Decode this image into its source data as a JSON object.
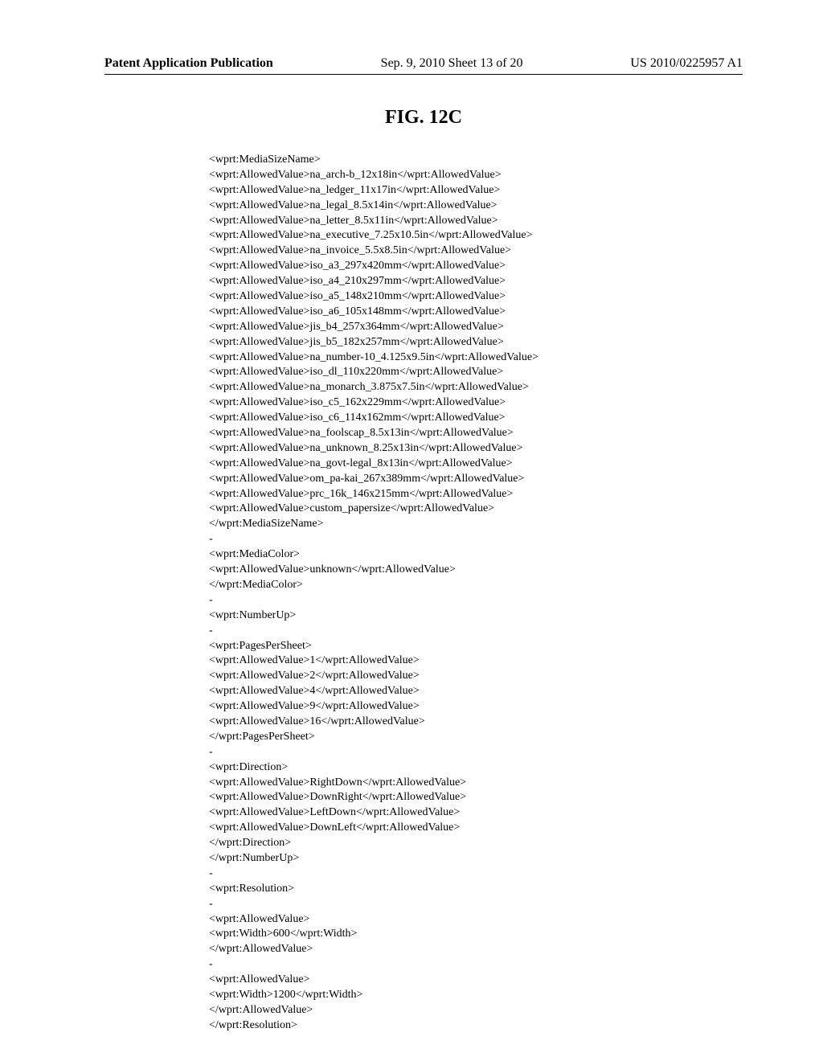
{
  "header": {
    "left": "Patent Application Publication",
    "center": "Sep. 9, 2010  Sheet 13 of 20",
    "right": "US 2010/0225957 A1"
  },
  "figure_title": "FIG. 12C",
  "xml": {
    "media_size_name": {
      "open": "<wprt:MediaSizeName>",
      "lines": [
        "<wprt:AllowedValue>na_arch-b_12x18in</wprt:AllowedValue>",
        "<wprt:AllowedValue>na_ledger_11x17in</wprt:AllowedValue>",
        "<wprt:AllowedValue>na_legal_8.5x14in</wprt:AllowedValue>",
        "<wprt:AllowedValue>na_letter_8.5x11in</wprt:AllowedValue>",
        "<wprt:AllowedValue>na_executive_7.25x10.5in</wprt:AllowedValue>",
        "<wprt:AllowedValue>na_invoice_5.5x8.5in</wprt:AllowedValue>",
        "<wprt:AllowedValue>iso_a3_297x420mm</wprt:AllowedValue>",
        "<wprt:AllowedValue>iso_a4_210x297mm</wprt:AllowedValue>",
        "<wprt:AllowedValue>iso_a5_148x210mm</wprt:AllowedValue>",
        "<wprt:AllowedValue>iso_a6_105x148mm</wprt:AllowedValue>",
        "<wprt:AllowedValue>jis_b4_257x364mm</wprt:AllowedValue>",
        "<wprt:AllowedValue>jis_b5_182x257mm</wprt:AllowedValue>",
        "<wprt:AllowedValue>na_number-10_4.125x9.5in</wprt:AllowedValue>",
        "<wprt:AllowedValue>iso_dl_110x220mm</wprt:AllowedValue>",
        "<wprt:AllowedValue>na_monarch_3.875x7.5in</wprt:AllowedValue>",
        "<wprt:AllowedValue>iso_c5_162x229mm</wprt:AllowedValue>",
        "<wprt:AllowedValue>iso_c6_114x162mm</wprt:AllowedValue>",
        "<wprt:AllowedValue>na_foolscap_8.5x13in</wprt:AllowedValue>",
        "<wprt:AllowedValue>na_unknown_8.25x13in</wprt:AllowedValue>",
        "<wprt:AllowedValue>na_govt-legal_8x13in</wprt:AllowedValue>",
        "<wprt:AllowedValue>om_pa-kai_267x389mm</wprt:AllowedValue>",
        "<wprt:AllowedValue>prc_16k_146x215mm</wprt:AllowedValue>",
        "<wprt:AllowedValue>custom_papersize</wprt:AllowedValue>"
      ],
      "close": "</wprt:MediaSizeName>"
    },
    "dash1": "-",
    "media_color": {
      "open": "<wprt:MediaColor>",
      "line": "<wprt:AllowedValue>unknown</wprt:AllowedValue>",
      "close": "</wprt:MediaColor>"
    },
    "dash2": "-",
    "number_up": {
      "open": "<wprt:NumberUp>",
      "dash": "-",
      "pages_per_sheet": {
        "open": "<wprt:PagesPerSheet>",
        "lines": [
          "<wprt:AllowedValue>1</wprt:AllowedValue>",
          "<wprt:AllowedValue>2</wprt:AllowedValue>",
          "<wprt:AllowedValue>4</wprt:AllowedValue>",
          "<wprt:AllowedValue>9</wprt:AllowedValue>",
          "<wprt:AllowedValue>16</wprt:AllowedValue>"
        ],
        "close": "</wprt:PagesPerSheet>"
      },
      "dash2": "-",
      "direction": {
        "open": "<wprt:Direction>",
        "lines": [
          "<wprt:AllowedValue>RightDown</wprt:AllowedValue>",
          "<wprt:AllowedValue>DownRight</wprt:AllowedValue>",
          "<wprt:AllowedValue>LeftDown</wprt:AllowedValue>",
          "<wprt:AllowedValue>DownLeft</wprt:AllowedValue>"
        ],
        "close": "</wprt:Direction>"
      },
      "close": "</wprt:NumberUp>"
    },
    "dash3": "-",
    "resolution": {
      "open": "<wprt:Resolution>",
      "dash": "-",
      "av1_open": "<wprt:AllowedValue>",
      "av1_width": "<wprt:Width>600</wprt:Width>",
      "av1_close": "</wprt:AllowedValue>",
      "dash2": "-",
      "av2_open": "<wprt:AllowedValue>",
      "av2_width": "<wprt:Width>1200</wprt:Width>",
      "av2_close": "</wprt:AllowedValue>",
      "close": "</wprt:Resolution>"
    }
  }
}
